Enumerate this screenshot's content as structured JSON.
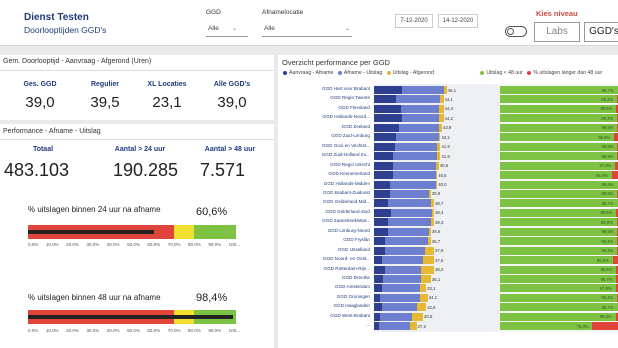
{
  "header": {
    "title": "Dienst Testen",
    "subtitle": "Doorlooptijden GGD's",
    "filter_ggd": {
      "label": "GGD",
      "value": "Alle"
    },
    "filter_afname": {
      "label": "Afnamelocatie",
      "value": "Alle"
    },
    "date_from": "7-12-2020",
    "date_to": "14-12-2020",
    "kies_niveau": "Kies niveau",
    "level_buttons": [
      "Labs",
      "GGD's"
    ]
  },
  "kpi_panel": {
    "title": "Gem. Doorlooptijd - Aanvraag - Afgerond (Uren)",
    "items": [
      {
        "label": "Ges. GGD",
        "value": "39,0"
      },
      {
        "label": "Regulier",
        "value": "39,5"
      },
      {
        "label": "XL Locaties",
        "value": "23,1"
      },
      {
        "label": "Alle GGD's",
        "value": "39,0"
      }
    ]
  },
  "perf_panel": {
    "title": "Performance - Afname - Uitslag",
    "items": [
      {
        "label": "Totaal",
        "value": "483.103"
      },
      {
        "label": "Aantal > 24 uur",
        "value": "190.285"
      },
      {
        "label": "Aantal > 48 uur",
        "value": "7.571"
      }
    ],
    "gauges": [
      {
        "label": "% uitslagen binnen 24 uur na afname",
        "value": "60,6%",
        "fraction": 0.606
      },
      {
        "label": "% uitslagen binnen 48 uur na afname",
        "value": "98,4%",
        "fraction": 0.984
      }
    ],
    "ticks": [
      "0.0%",
      "10.0%",
      "20.0%",
      "30.0%",
      "40.0%",
      "50.0%",
      "60.0%",
      "70.0%",
      "80.0%",
      "90.0%",
      "100..."
    ]
  },
  "overview": {
    "title": "Overzicht performance per GGD",
    "legend": [
      {
        "label": "Aanvraag - Afname",
        "color": "#2e3f8f"
      },
      {
        "label": "Afname - Uitslag",
        "color": "#6f7fd0"
      },
      {
        "label": "Uitslag - Afgerond",
        "color": "#e7b832"
      }
    ],
    "legend2": [
      {
        "label": "Uitslag < 48 uur",
        "color": "#7dc242"
      },
      {
        "label": "% uitslagen langer dan 48 uur",
        "color": "#e0443a"
      }
    ],
    "colors": {
      "a": "#2e3f8f",
      "b": "#6f7fd0",
      "c": "#e7b832",
      "green": "#7dc242",
      "red": "#e0443a"
    }
  },
  "chart_data": {
    "type": "bar",
    "categories": [
      "GGD Hart voor Brabant",
      "GGD Regio Twente",
      "GGD Flevoland",
      "GGD Hollands-Noord...",
      "GGD Zeeland",
      "GGD Zuid-Limburg",
      "GGD Gooi en Vechtst...",
      "GGD Zuid-Holland Zu...",
      "GGD Regio Utrecht",
      "GGD Kennemerland",
      "GGD Hollands-Midden",
      "GGD Brabant-Zuidoost",
      "GGD Gelderland-Mid...",
      "GGD Gelderland-Zuid",
      "GGD Zaanstreek/Wat...",
      "GGD Limburg-Noord",
      "GGD Fryslân",
      "GGD IJsselland",
      "GGD Noord- en Oost...",
      "GGD Rotterdam-Rijn...",
      "GGD Drenthe",
      "GGD Amsterdam",
      "GGD Groningen",
      "GGD Haaglanden",
      "GGD West-Brabant",
      "..."
    ],
    "series": [
      {
        "name": "Aanvraag - Afname",
        "values": [
          18,
          14,
          17,
          18,
          16,
          14,
          13,
          12,
          12,
          12,
          10,
          10,
          9,
          11,
          9,
          9,
          7,
          7,
          5,
          7,
          6,
          5,
          4,
          5,
          4,
          3
        ]
      },
      {
        "name": "Afname - Uitslag",
        "values": [
          26,
          28,
          24,
          23,
          25,
          27,
          27,
          28,
          27,
          27,
          29,
          25,
          27,
          26,
          27,
          26,
          27,
          25,
          26,
          23,
          24,
          24,
          25,
          22,
          20,
          20
        ]
      },
      {
        "name": "Uitslag - Afgerond",
        "values": [
          2,
          2,
          3,
          3,
          2,
          1,
          2,
          2,
          2,
          1,
          1,
          1,
          2,
          1,
          2,
          1,
          2,
          6,
          7,
          8,
          6,
          4,
          5,
          6,
          7,
          4
        ]
      }
    ],
    "totals": [
      "46,1",
      "44,1",
      "44,3",
      "44,2",
      "43,9",
      "42,2",
      "41,9",
      "41,9",
      "40,6",
      "40,5",
      "40,0",
      "35,9",
      "38,7",
      "38,4",
      "38,3",
      "36,6",
      "36,7",
      "37,9",
      "37,6",
      "38,2",
      "36,1",
      "33,1",
      "34,1",
      "32,6",
      "30,5",
      "27,2"
    ],
    "pct_within_48h": {
      "values": [
        99.7,
        99.3,
        98.6,
        99.3,
        99.5,
        96.8,
        99.5,
        99.5,
        97.8,
        94.9,
        99.6,
        99.5,
        99.7,
        98.6,
        99.0,
        99.5,
        99.4,
        99.4,
        95.5,
        98.6,
        98.7,
        97.9,
        99.4,
        99.7,
        98.0,
        78.3
      ],
      "labels": [
        "99,7%",
        "99,3%",
        "98,6%",
        "99,3%",
        "99,5%",
        "96,8%",
        "99,5%",
        "99,5%",
        "97,8%",
        "94,9%",
        "99,6%",
        "99,5%",
        "99,7%",
        "98,6%",
        "99,0%",
        "99,5%",
        "99,4%",
        "99,4%",
        "95,5%",
        "98,6%",
        "98,7%",
        "97,9%",
        "99,4%",
        "99,7%",
        "98,0%",
        "78,3%"
      ]
    }
  }
}
